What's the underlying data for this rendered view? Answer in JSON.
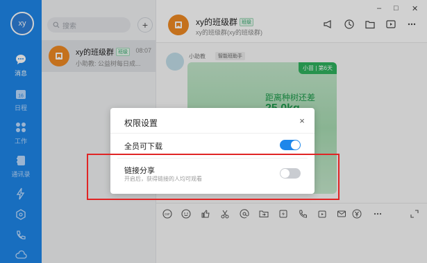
{
  "user": {
    "avatar_text": "xy"
  },
  "nav": [
    {
      "key": "messages",
      "label": "消息",
      "icon": "chat-bubble-icon",
      "active": true
    },
    {
      "key": "calendar",
      "label": "日程",
      "icon": "calendar-icon",
      "day": "16"
    },
    {
      "key": "work",
      "label": "工作",
      "icon": "apps-grid-icon"
    },
    {
      "key": "contacts",
      "label": "通讯录",
      "icon": "contacts-book-icon"
    },
    {
      "key": "lightning",
      "label": "",
      "icon": "lightning-icon"
    },
    {
      "key": "cube",
      "label": "",
      "icon": "cube-icon"
    },
    {
      "key": "phone",
      "label": "",
      "icon": "phone-icon"
    },
    {
      "key": "cloud",
      "label": "",
      "icon": "cloud-icon"
    }
  ],
  "search": {
    "placeholder": "搜索"
  },
  "chat_list": [
    {
      "name": "xy的班级群",
      "tag": "班级",
      "time": "08:07",
      "preview": "小助教: 公益树每日成..."
    }
  ],
  "header": {
    "group_name": "xy的班级群",
    "group_tag": "班级",
    "subtitle": "xy的班级群(xy的班级群)"
  },
  "window_controls": {
    "minimize": "–",
    "maximize": "□",
    "close": "✕"
  },
  "message": {
    "sender": "小助教",
    "sender_tag": "智能班助手",
    "card_badge": "小苗 | 第6天",
    "card_title": "距离种树还差",
    "card_value": "25.0kg"
  },
  "dialog": {
    "title": "权限设置",
    "close": "×",
    "rows": [
      {
        "label": "全员可下载",
        "sub": "",
        "enabled": true
      },
      {
        "label": "链接分享",
        "sub": "开启后，获得链接的人均可观看",
        "enabled": false
      }
    ]
  },
  "toolbar_icons": [
    "gif-icon",
    "emoji-icon",
    "thumbs-up-icon",
    "scissors-icon",
    "at-icon",
    "folder-send-icon",
    "lightning-doc-icon",
    "phone-call-icon",
    "live-video-icon",
    "mail-icon",
    "rmb-icon",
    "more-icon",
    "expand-icon"
  ],
  "colors": {
    "accent": "#1e87ea",
    "highlight": "#e02424",
    "group_avatar": "#f08a24"
  }
}
